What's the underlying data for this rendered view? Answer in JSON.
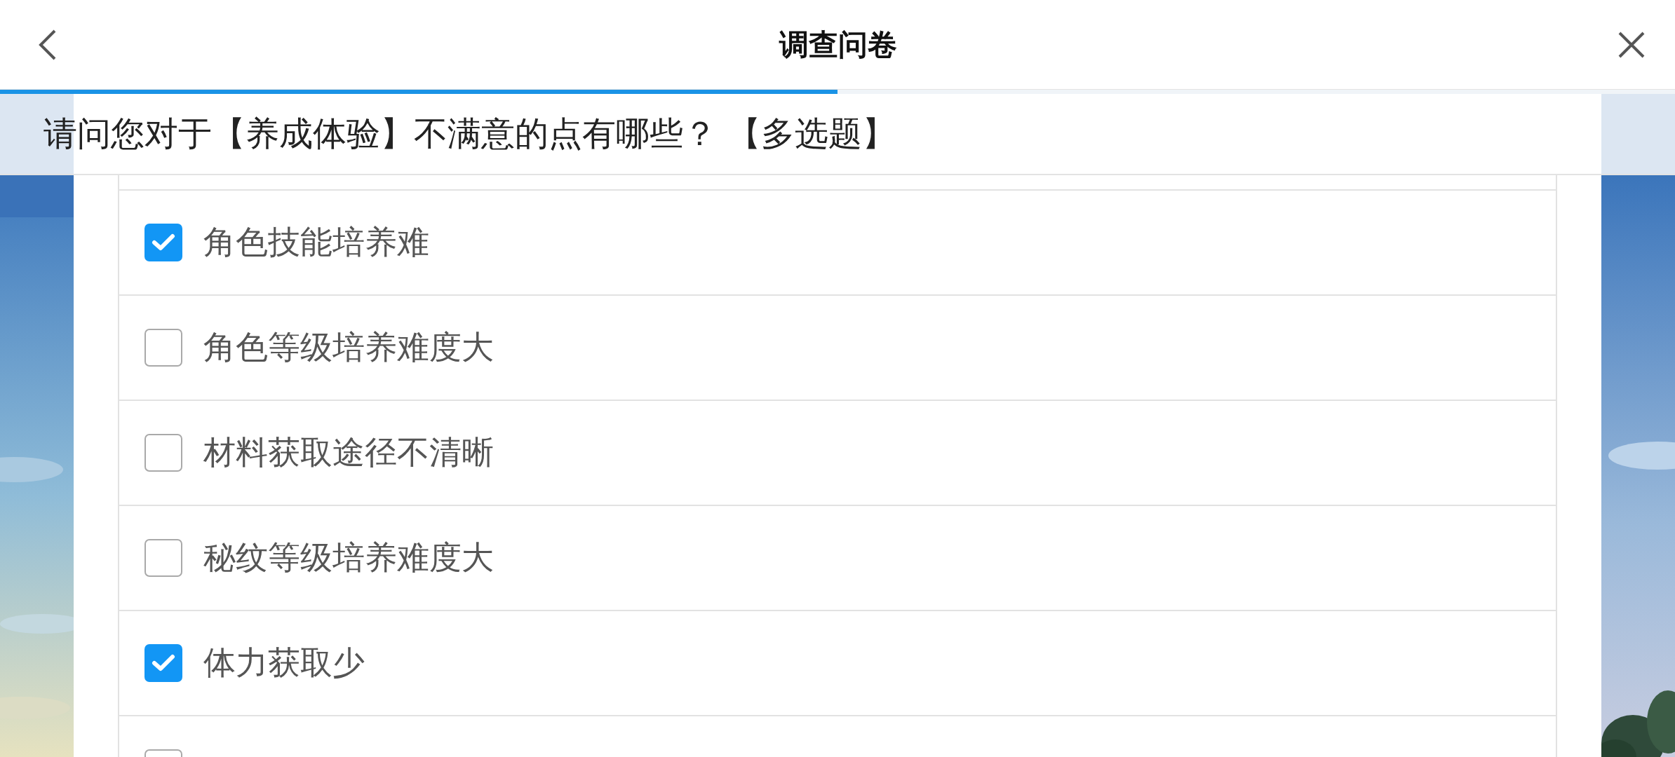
{
  "header": {
    "title": "调查问卷"
  },
  "progress": {
    "level": 0.5
  },
  "question": {
    "text": "请问您对于【养成体验】不满意的点有哪些？ 【多选题】"
  },
  "options": [
    {
      "label": "角色技能培养难",
      "checked": true
    },
    {
      "label": "角色等级培养难度大",
      "checked": false
    },
    {
      "label": "材料获取途径不清晰",
      "checked": false
    },
    {
      "label": "秘纹等级培养难度大",
      "checked": false
    },
    {
      "label": "体力获取少",
      "checked": true
    },
    {
      "checked": false
    }
  ]
}
